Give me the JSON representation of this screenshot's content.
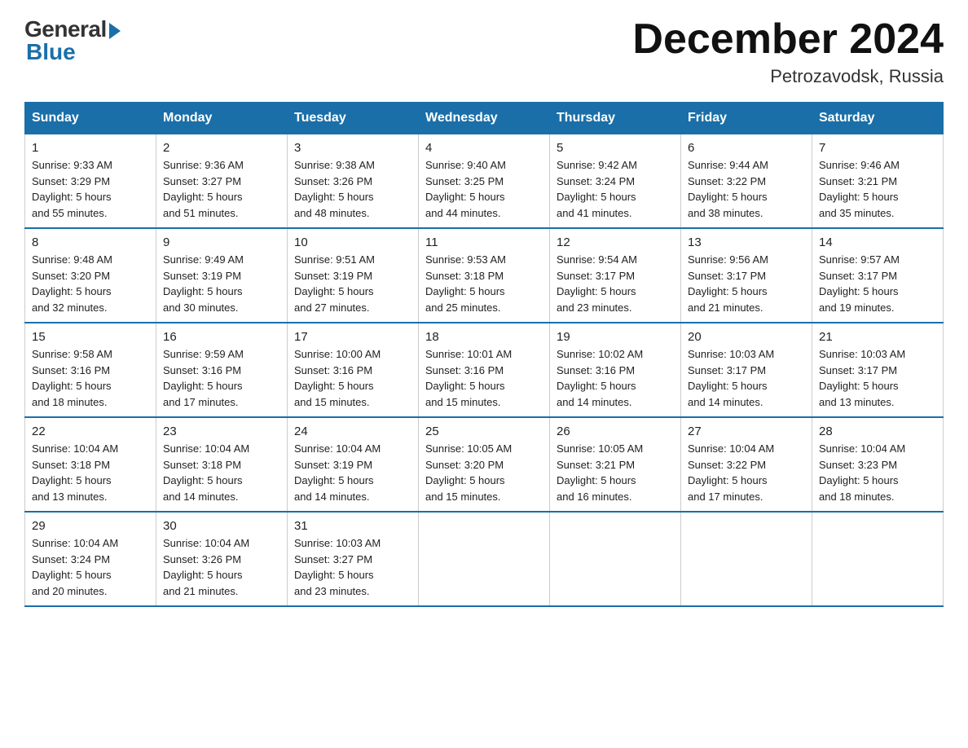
{
  "logo": {
    "general": "General",
    "blue": "Blue"
  },
  "header": {
    "month_year": "December 2024",
    "location": "Petrozavodsk, Russia"
  },
  "days_of_week": [
    "Sunday",
    "Monday",
    "Tuesday",
    "Wednesday",
    "Thursday",
    "Friday",
    "Saturday"
  ],
  "weeks": [
    [
      {
        "day": "1",
        "sunrise": "9:33 AM",
        "sunset": "3:29 PM",
        "daylight": "5 hours and 55 minutes."
      },
      {
        "day": "2",
        "sunrise": "9:36 AM",
        "sunset": "3:27 PM",
        "daylight": "5 hours and 51 minutes."
      },
      {
        "day": "3",
        "sunrise": "9:38 AM",
        "sunset": "3:26 PM",
        "daylight": "5 hours and 48 minutes."
      },
      {
        "day": "4",
        "sunrise": "9:40 AM",
        "sunset": "3:25 PM",
        "daylight": "5 hours and 44 minutes."
      },
      {
        "day": "5",
        "sunrise": "9:42 AM",
        "sunset": "3:24 PM",
        "daylight": "5 hours and 41 minutes."
      },
      {
        "day": "6",
        "sunrise": "9:44 AM",
        "sunset": "3:22 PM",
        "daylight": "5 hours and 38 minutes."
      },
      {
        "day": "7",
        "sunrise": "9:46 AM",
        "sunset": "3:21 PM",
        "daylight": "5 hours and 35 minutes."
      }
    ],
    [
      {
        "day": "8",
        "sunrise": "9:48 AM",
        "sunset": "3:20 PM",
        "daylight": "5 hours and 32 minutes."
      },
      {
        "day": "9",
        "sunrise": "9:49 AM",
        "sunset": "3:19 PM",
        "daylight": "5 hours and 30 minutes."
      },
      {
        "day": "10",
        "sunrise": "9:51 AM",
        "sunset": "3:19 PM",
        "daylight": "5 hours and 27 minutes."
      },
      {
        "day": "11",
        "sunrise": "9:53 AM",
        "sunset": "3:18 PM",
        "daylight": "5 hours and 25 minutes."
      },
      {
        "day": "12",
        "sunrise": "9:54 AM",
        "sunset": "3:17 PM",
        "daylight": "5 hours and 23 minutes."
      },
      {
        "day": "13",
        "sunrise": "9:56 AM",
        "sunset": "3:17 PM",
        "daylight": "5 hours and 21 minutes."
      },
      {
        "day": "14",
        "sunrise": "9:57 AM",
        "sunset": "3:17 PM",
        "daylight": "5 hours and 19 minutes."
      }
    ],
    [
      {
        "day": "15",
        "sunrise": "9:58 AM",
        "sunset": "3:16 PM",
        "daylight": "5 hours and 18 minutes."
      },
      {
        "day": "16",
        "sunrise": "9:59 AM",
        "sunset": "3:16 PM",
        "daylight": "5 hours and 17 minutes."
      },
      {
        "day": "17",
        "sunrise": "10:00 AM",
        "sunset": "3:16 PM",
        "daylight": "5 hours and 15 minutes."
      },
      {
        "day": "18",
        "sunrise": "10:01 AM",
        "sunset": "3:16 PM",
        "daylight": "5 hours and 15 minutes."
      },
      {
        "day": "19",
        "sunrise": "10:02 AM",
        "sunset": "3:16 PM",
        "daylight": "5 hours and 14 minutes."
      },
      {
        "day": "20",
        "sunrise": "10:03 AM",
        "sunset": "3:17 PM",
        "daylight": "5 hours and 14 minutes."
      },
      {
        "day": "21",
        "sunrise": "10:03 AM",
        "sunset": "3:17 PM",
        "daylight": "5 hours and 13 minutes."
      }
    ],
    [
      {
        "day": "22",
        "sunrise": "10:04 AM",
        "sunset": "3:18 PM",
        "daylight": "5 hours and 13 minutes."
      },
      {
        "day": "23",
        "sunrise": "10:04 AM",
        "sunset": "3:18 PM",
        "daylight": "5 hours and 14 minutes."
      },
      {
        "day": "24",
        "sunrise": "10:04 AM",
        "sunset": "3:19 PM",
        "daylight": "5 hours and 14 minutes."
      },
      {
        "day": "25",
        "sunrise": "10:05 AM",
        "sunset": "3:20 PM",
        "daylight": "5 hours and 15 minutes."
      },
      {
        "day": "26",
        "sunrise": "10:05 AM",
        "sunset": "3:21 PM",
        "daylight": "5 hours and 16 minutes."
      },
      {
        "day": "27",
        "sunrise": "10:04 AM",
        "sunset": "3:22 PM",
        "daylight": "5 hours and 17 minutes."
      },
      {
        "day": "28",
        "sunrise": "10:04 AM",
        "sunset": "3:23 PM",
        "daylight": "5 hours and 18 minutes."
      }
    ],
    [
      {
        "day": "29",
        "sunrise": "10:04 AM",
        "sunset": "3:24 PM",
        "daylight": "5 hours and 20 minutes."
      },
      {
        "day": "30",
        "sunrise": "10:04 AM",
        "sunset": "3:26 PM",
        "daylight": "5 hours and 21 minutes."
      },
      {
        "day": "31",
        "sunrise": "10:03 AM",
        "sunset": "3:27 PM",
        "daylight": "5 hours and 23 minutes."
      },
      null,
      null,
      null,
      null
    ]
  ],
  "labels": {
    "sunrise": "Sunrise:",
    "sunset": "Sunset:",
    "daylight": "Daylight:"
  }
}
